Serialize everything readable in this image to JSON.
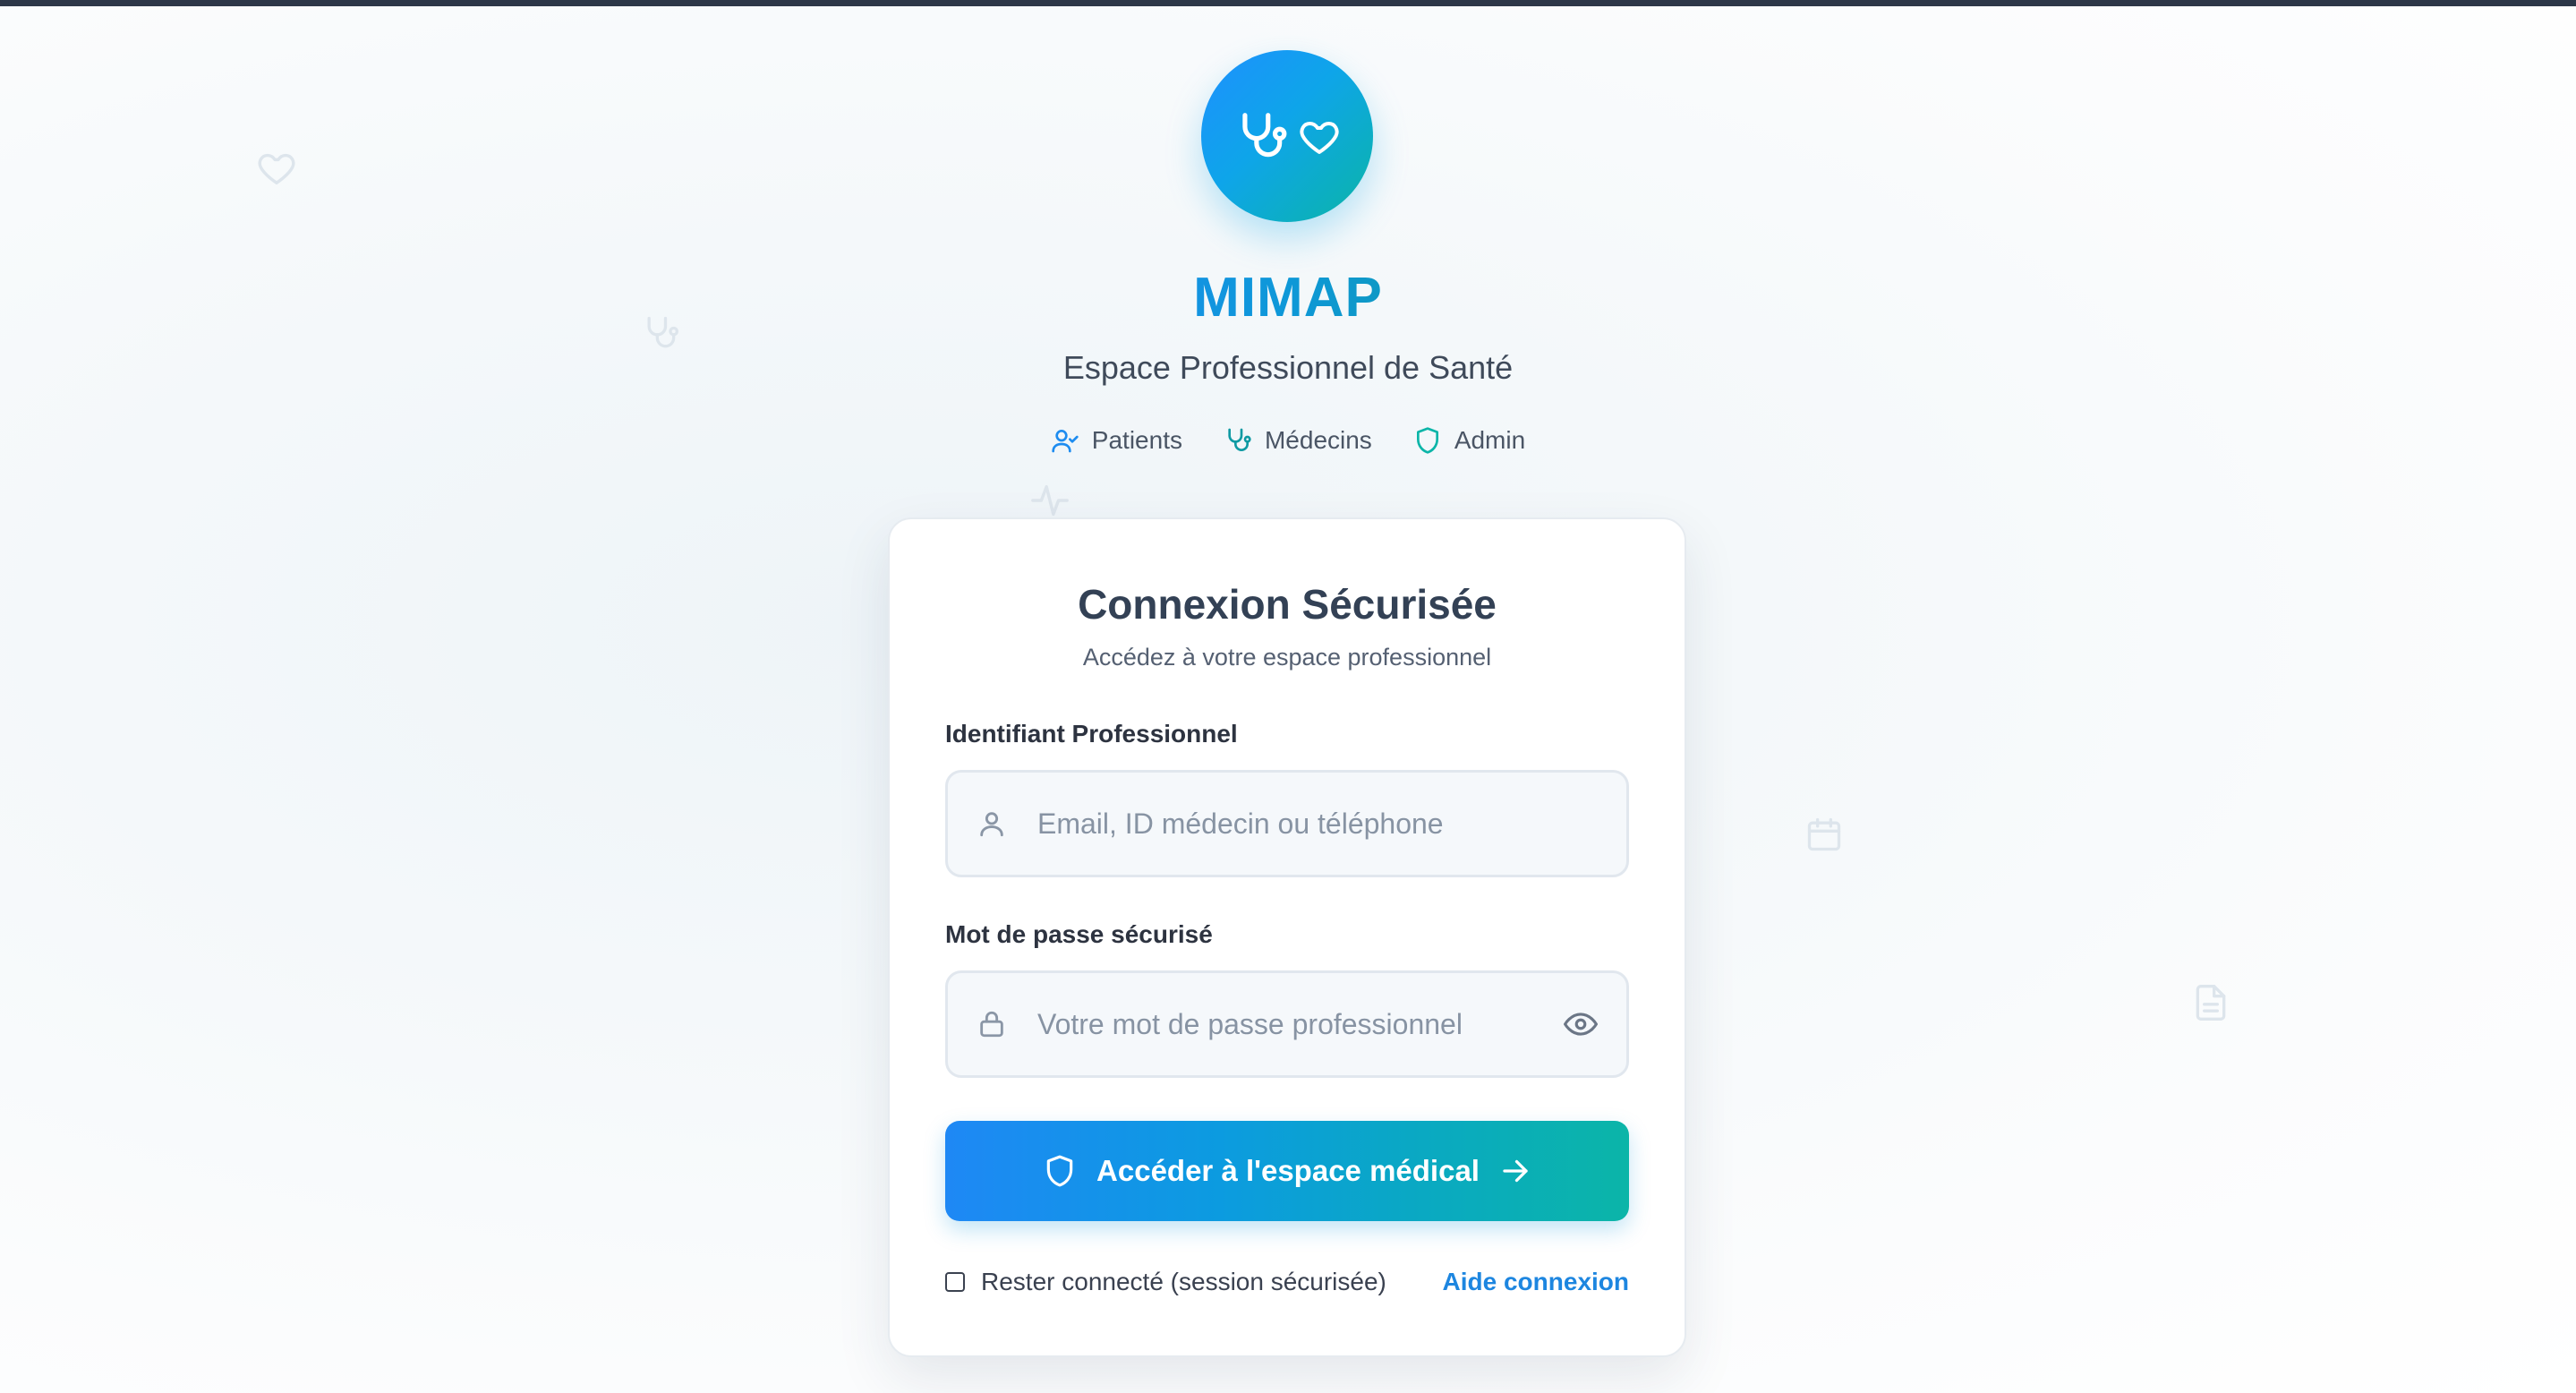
{
  "app": {
    "name": "MIMAP",
    "tagline": "Espace Professionnel de Santé"
  },
  "roles": [
    {
      "label": "Patients",
      "icon": "users-icon"
    },
    {
      "label": "Médecins",
      "icon": "stethoscope-icon"
    },
    {
      "label": "Admin",
      "icon": "shield-icon"
    }
  ],
  "login": {
    "title": "Connexion Sécurisée",
    "subtitle": "Accédez à votre espace professionnel",
    "identifier_label": "Identifiant Professionnel",
    "identifier_placeholder": "Email, ID médecin ou téléphone",
    "identifier_value": "",
    "password_label": "Mot de passe sécurisé",
    "password_placeholder": "Votre mot de passe professionnel",
    "password_value": "",
    "submit_label": "Accéder à l'espace médical",
    "remember_label": "Rester connecté (session sécurisée)",
    "remember_checked": false,
    "help_label": "Aide connexion"
  },
  "colors": {
    "primary_blue": "#1e88f5",
    "accent_teal": "#0bb5a8",
    "link": "#1d86e0",
    "icon_teal": "#0f9aa3"
  }
}
